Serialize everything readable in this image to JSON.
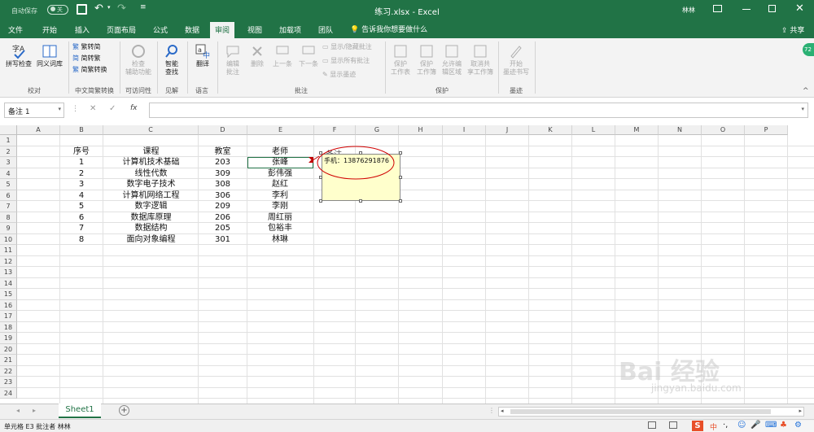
{
  "titlebar": {
    "autosave_label": "自动保存",
    "autosave_state": "关",
    "title": "练习.xlsx - Excel",
    "user": "林林"
  },
  "tabs": [
    {
      "label": "文件"
    },
    {
      "label": "开始"
    },
    {
      "label": "插入"
    },
    {
      "label": "页面布局"
    },
    {
      "label": "公式"
    },
    {
      "label": "数据"
    },
    {
      "label": "审阅"
    },
    {
      "label": "视图"
    },
    {
      "label": "加载项"
    },
    {
      "label": "团队"
    }
  ],
  "tell_me": "告诉我你想要做什么",
  "share_label": "共享",
  "ribbon": {
    "proofing": {
      "spell": "拼写检查",
      "thesaurus": "同义词库",
      "group": "校对"
    },
    "chinese": {
      "t2s": "繁转简",
      "s2t": "简转繁",
      "convert": "简繁转换",
      "group": "中文简繁转换"
    },
    "access": {
      "line1": "检查",
      "line2": "辅助功能",
      "group": "可访问性"
    },
    "insights": {
      "line1": "智能",
      "line2": "查找",
      "group": "见解"
    },
    "language": {
      "translate": "翻译",
      "group": "语言"
    },
    "comments": {
      "edit1": "编辑",
      "edit2": "批注",
      "delete": "删除",
      "prev": "上一条",
      "next": "下一条",
      "show_hide": "显示/隐藏批注",
      "show_all": "显示所有批注",
      "show_ink": "显示墨迹",
      "group": "批注"
    },
    "protect": {
      "sheet1": "保护",
      "sheet2": "工作表",
      "wb1": "保护",
      "wb2": "工作簿",
      "allow1": "允许编",
      "allow2": "辑区域",
      "unshare1": "取消共",
      "unshare2": "享工作簿",
      "group": "保护"
    },
    "ink": {
      "line1": "开始",
      "line2": "墨迹书写",
      "group": "墨迹"
    }
  },
  "namebox": "备注 1",
  "fx": "fx",
  "columns": [
    "A",
    "B",
    "C",
    "D",
    "E",
    "F",
    "G",
    "H",
    "I",
    "J",
    "K",
    "L",
    "M",
    "N",
    "O",
    "P"
  ],
  "rows": [
    "1",
    "2",
    "3",
    "4",
    "5",
    "6",
    "7",
    "8",
    "9",
    "10",
    "11",
    "12",
    "13",
    "14",
    "15",
    "16",
    "17",
    "18",
    "19",
    "20",
    "21",
    "22",
    "23",
    "24"
  ],
  "table": {
    "headers": [
      "序号",
      "课程",
      "教室",
      "老师"
    ],
    "rows": [
      [
        "1",
        "计算机技术基础",
        "203",
        "张峰"
      ],
      [
        "2",
        "线性代数",
        "309",
        "彭伟强"
      ],
      [
        "3",
        "数字电子技术",
        "308",
        "赵红"
      ],
      [
        "4",
        "计算机网络工程",
        "306",
        "李利"
      ],
      [
        "5",
        "数字逻辑",
        "209",
        "李刚"
      ],
      [
        "6",
        "数据库原理",
        "206",
        "周红丽"
      ],
      [
        "7",
        "数据结构",
        "205",
        "包裕丰"
      ],
      [
        "8",
        "面向对象编程",
        "301",
        "林琳"
      ]
    ]
  },
  "comment": {
    "text": "手机：13876291876",
    "partial": "备注"
  },
  "sheet_tab": "Sheet1",
  "status": {
    "text": "单元格 E3 批注者 林林",
    "badge": "72"
  },
  "watermark": {
    "text": "Bai 经验",
    "url": "jingyan.baidu.com"
  },
  "colors": {
    "accent": "#217346",
    "comment_fill": "#ffffcc",
    "highlight": "#d00000"
  }
}
